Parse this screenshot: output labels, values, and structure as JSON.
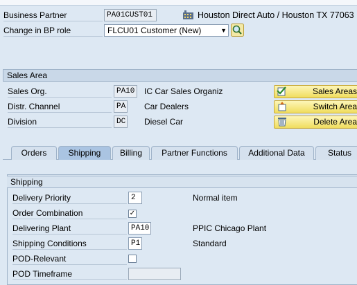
{
  "header": {
    "bp_label": "Business Partner",
    "bp_value": "PA01CUST01",
    "bp_description": "Houston Direct Auto / Houston TX 77063",
    "role_label": "Change in BP role",
    "role_value": "FLCU01 Customer (New)"
  },
  "sales_area": {
    "title": "Sales Area",
    "fields": [
      {
        "label": "Sales Org.",
        "code": "PA10",
        "desc": "IC Car Sales Organiz"
      },
      {
        "label": "Distr. Channel",
        "code": "PA",
        "desc": "Car Dealers"
      },
      {
        "label": "Division",
        "code": "DC",
        "desc": "Diesel Car"
      }
    ],
    "buttons": {
      "sales_areas": "Sales Areas",
      "switch_area": "Switch Area",
      "delete_area": "Delete Area"
    }
  },
  "tabs": [
    "Orders",
    "Shipping",
    "Billing",
    "Partner Functions",
    "Additional Data",
    "Status"
  ],
  "active_tab": "Shipping",
  "shipping": {
    "title": "Shipping",
    "delivery_priority_label": "Delivery Priority",
    "delivery_priority_value": "2",
    "delivery_priority_desc": "Normal item",
    "order_combination_label": "Order Combination",
    "order_combination_checked": true,
    "check_mark": "✓",
    "delivering_plant_label": "Delivering Plant",
    "delivering_plant_value": "PA10",
    "delivering_plant_desc": "PPIC Chicago Plant",
    "shipping_conditions_label": "Shipping Conditions",
    "shipping_conditions_value": "P1",
    "shipping_conditions_desc": "Standard",
    "pod_relevant_label": "POD-Relevant",
    "pod_relevant_checked": false,
    "pod_timeframe_label": "POD Timeframe",
    "pod_timeframe_value": ""
  },
  "icons": {
    "partner_type": "building-icon",
    "role_search": "search-icon",
    "sales_areas": "checklist-icon",
    "switch_area": "switch-icon",
    "delete_area": "trash-icon"
  }
}
